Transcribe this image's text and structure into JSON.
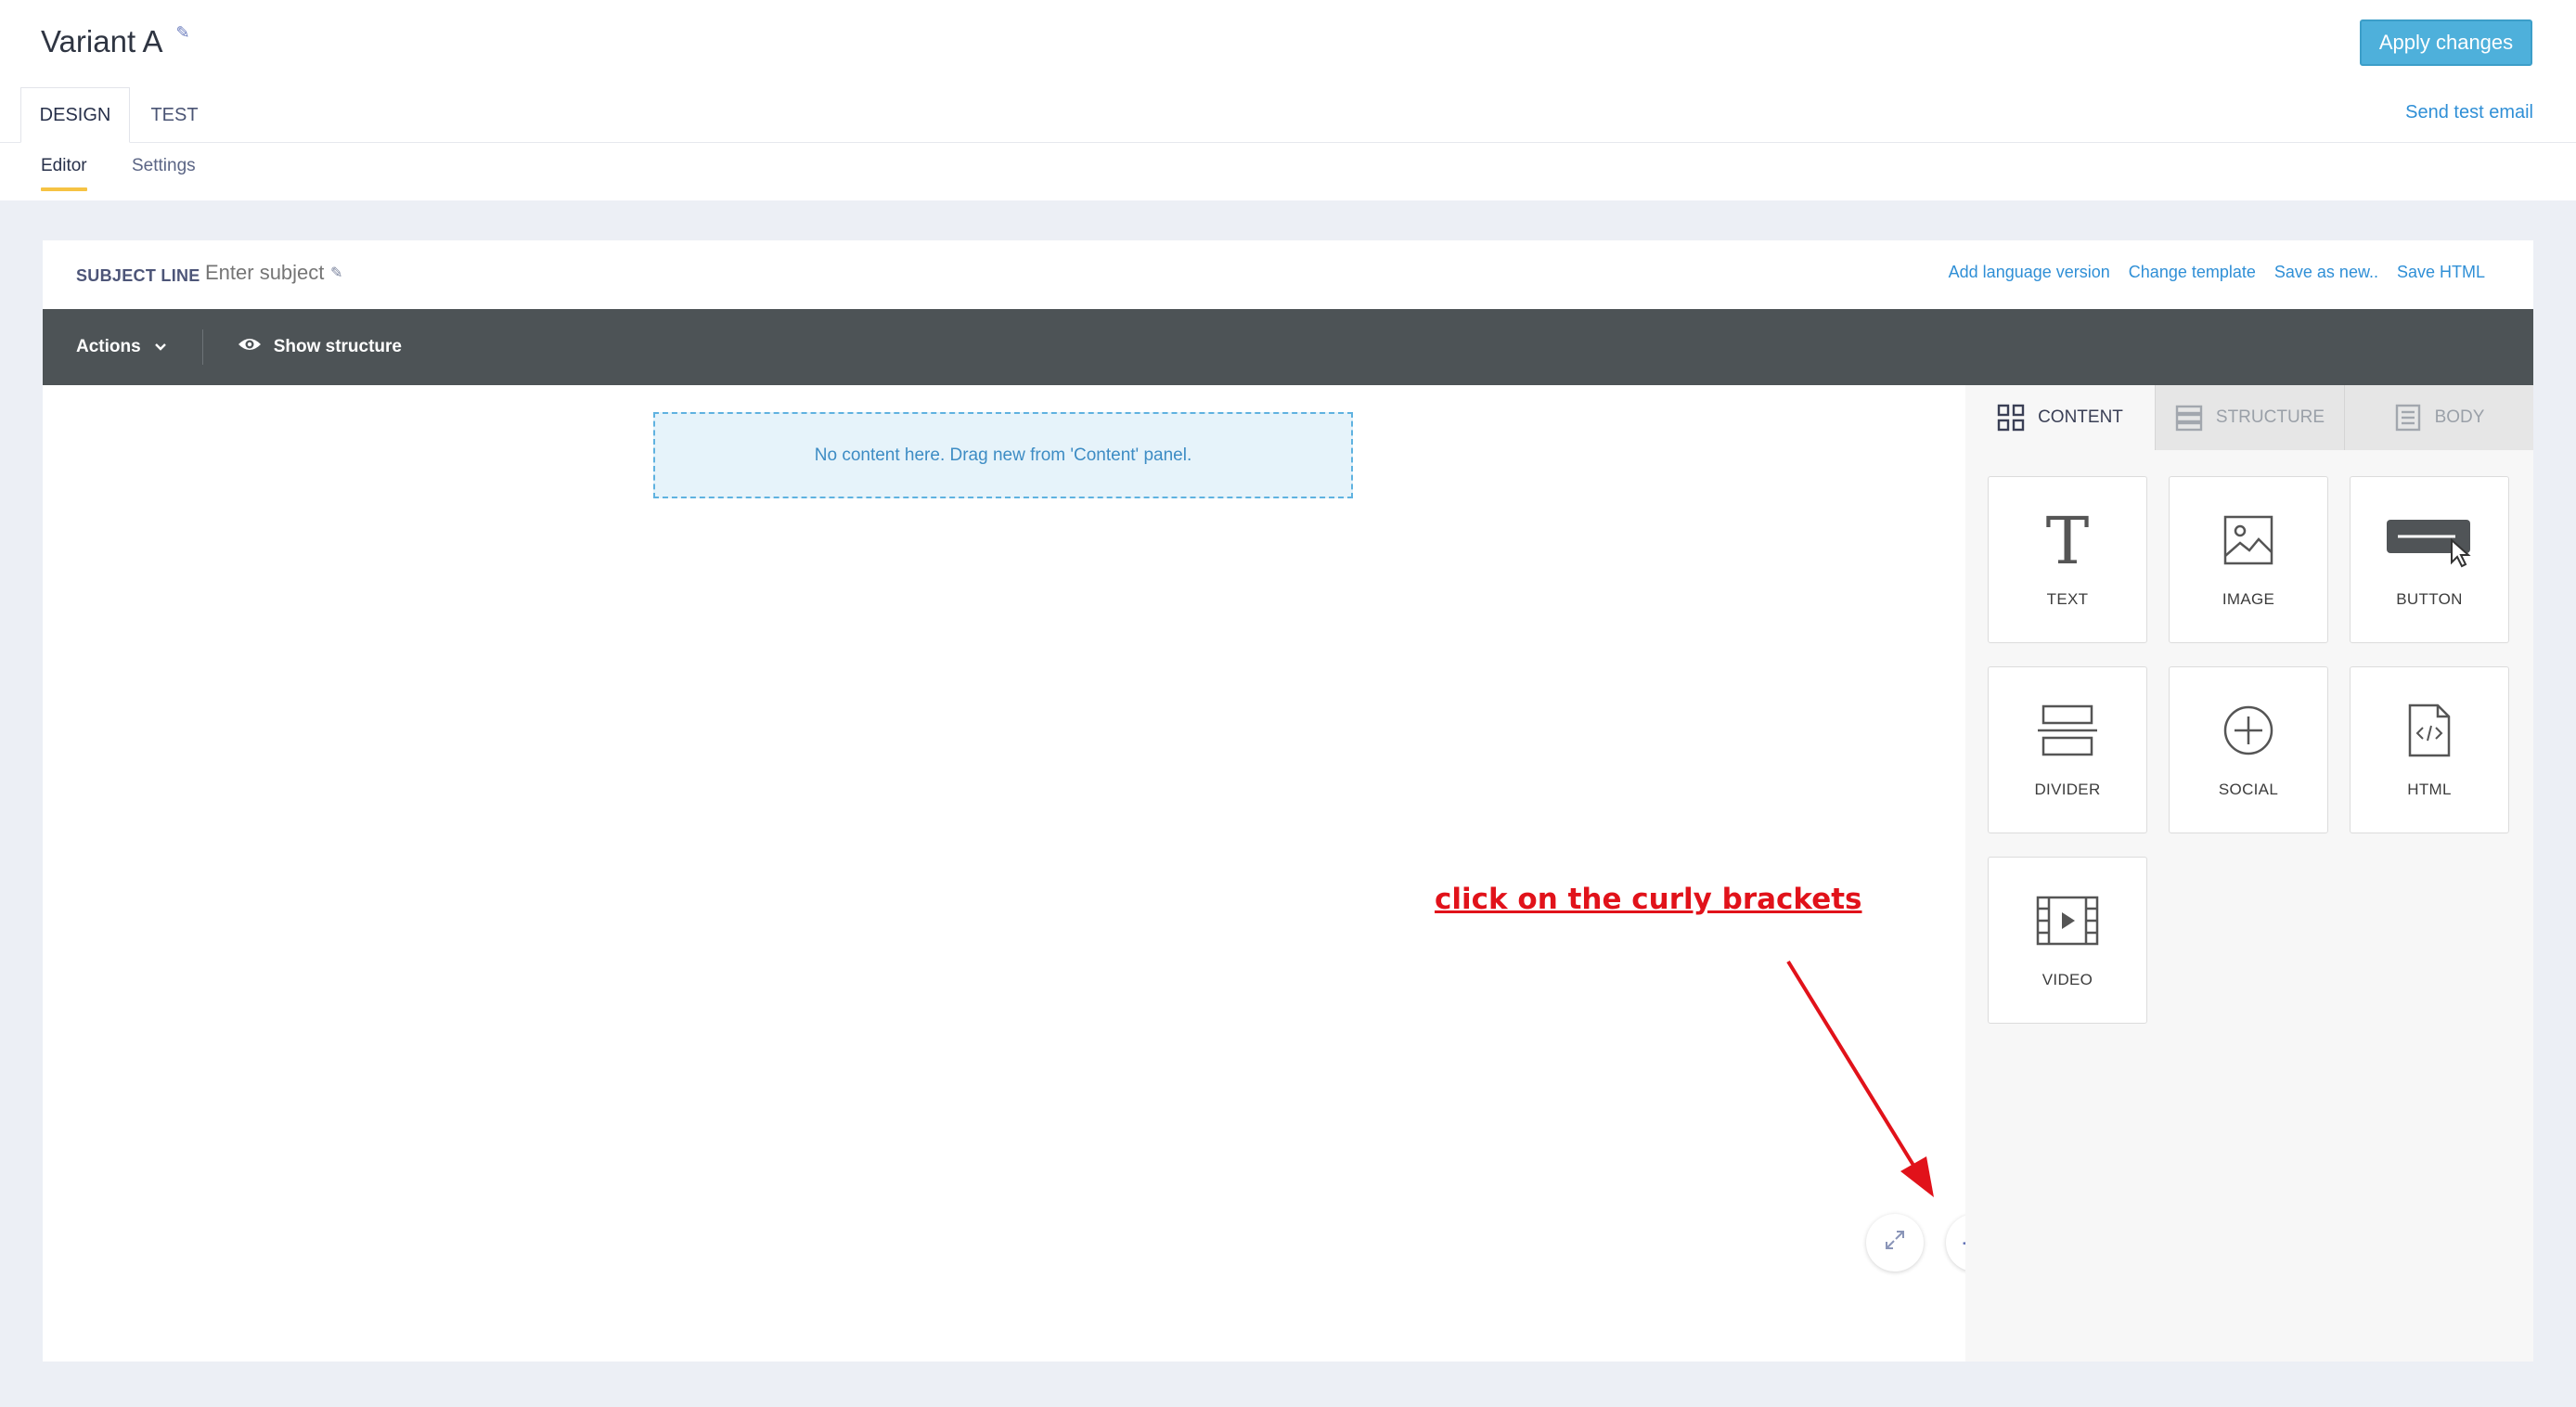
{
  "header": {
    "title": "Variant A",
    "apply_label": "Apply changes",
    "tabs": [
      {
        "label": "DESIGN"
      },
      {
        "label": "TEST"
      }
    ],
    "send_test_label": "Send test email",
    "subtabs": [
      {
        "label": "Editor"
      },
      {
        "label": "Settings"
      }
    ]
  },
  "subject": {
    "label": "SUBJECT LINE",
    "placeholder": "Enter subject",
    "value": ""
  },
  "top_links": [
    "Add language version",
    "Change template",
    "Save as new..",
    "Save HTML"
  ],
  "toolbar": {
    "actions_label": "Actions",
    "show_structure_label": "Show structure"
  },
  "canvas": {
    "empty_message": "No content here. Drag new from 'Content' panel."
  },
  "annotation": {
    "text": "click on the curly brackets",
    "color": "#e1121a"
  },
  "panel": {
    "tabs": [
      {
        "label": "CONTENT",
        "icon": "grid-icon",
        "active": true
      },
      {
        "label": "STRUCTURE",
        "icon": "rows-icon",
        "active": false
      },
      {
        "label": "BODY",
        "icon": "document-icon",
        "active": false
      }
    ],
    "blocks": [
      {
        "label": "TEXT",
        "icon": "text-icon"
      },
      {
        "label": "IMAGE",
        "icon": "image-icon"
      },
      {
        "label": "BUTTON",
        "icon": "button-icon"
      },
      {
        "label": "DIVIDER",
        "icon": "divider-icon"
      },
      {
        "label": "SOCIAL",
        "icon": "plus-circle-icon"
      },
      {
        "label": "HTML",
        "icon": "code-file-icon"
      },
      {
        "label": "VIDEO",
        "icon": "video-icon"
      }
    ]
  },
  "colors": {
    "accent": "#4eb0db",
    "link": "#2f8fd6",
    "toolbar": "#4d5356",
    "active_underline": "#f6c343"
  }
}
